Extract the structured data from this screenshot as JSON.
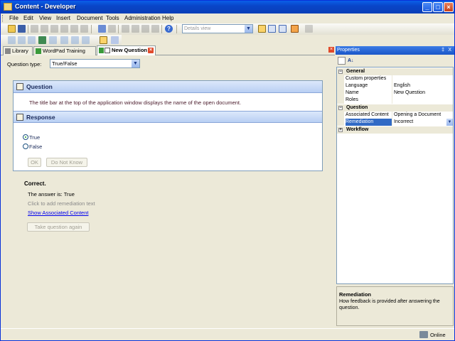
{
  "window": {
    "title": "Content - Developer"
  },
  "menu": [
    "File",
    "Edit",
    "View",
    "Insert",
    "Document",
    "Tools",
    "Administration",
    "Help"
  ],
  "toolbar": {
    "view_select": "Details view"
  },
  "tabs": [
    {
      "label": "Library"
    },
    {
      "label": "WordPad Training"
    },
    {
      "label": "New Question",
      "active": true
    }
  ],
  "editor": {
    "question_type_label": "Question type:",
    "question_type_value": "True/False",
    "question_header": "Question",
    "question_text": "The title bar at the top of the application window displays the name of the open document.",
    "response_header": "Response",
    "options": [
      {
        "label": "True",
        "selected": true
      },
      {
        "label": "False",
        "selected": false
      }
    ],
    "ok_label": "OK",
    "dont_know_label": "Do Not Know",
    "feedback_title": "Correct.",
    "answer_text": "The answer is: True",
    "remediation_hint": "Click to add remediation text",
    "associated_link": "Show Associated Content",
    "retake_label": "Take question again"
  },
  "properties": {
    "title": "Properties",
    "pin": "‡",
    "close": "X",
    "categories": [
      {
        "name": "General",
        "rows": [
          {
            "key": "Custom properties",
            "value": ""
          },
          {
            "key": "Language",
            "value": "English"
          },
          {
            "key": "Name",
            "value": "New Question"
          },
          {
            "key": "Roles",
            "value": ""
          }
        ]
      },
      {
        "name": "Question",
        "rows": [
          {
            "key": "Associated Content",
            "value": "Opening a Document"
          },
          {
            "key": "Remediation",
            "value": "Incorrect",
            "selected": true
          }
        ]
      },
      {
        "name": "Workflow",
        "rows": []
      }
    ],
    "desc_title": "Remediation",
    "desc_text": "How feedback is provided after answering the question."
  },
  "status": {
    "online": "Online"
  },
  "colors": {
    "titlebar": "#0a4fd8",
    "selection": "#316ac5",
    "link": "#0000ee"
  }
}
